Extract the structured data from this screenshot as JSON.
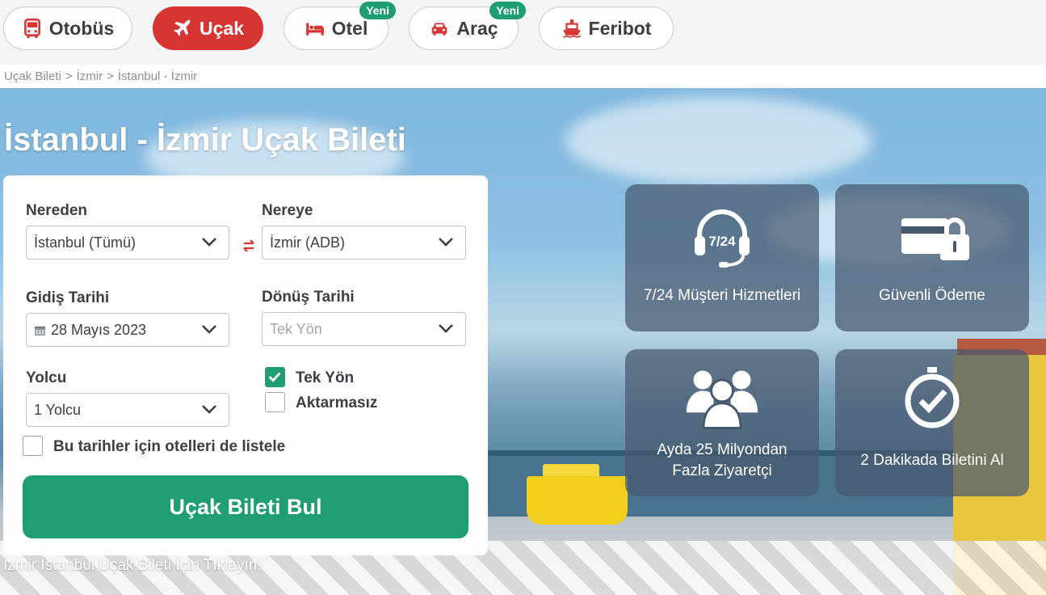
{
  "tabs": [
    {
      "label": "Otobüs",
      "icon": "bus-icon"
    },
    {
      "label": "Uçak",
      "icon": "plane-icon",
      "active": true
    },
    {
      "label": "Otel",
      "icon": "bed-icon",
      "badge": "Yeni"
    },
    {
      "label": "Araç",
      "icon": "car-icon",
      "badge": "Yeni"
    },
    {
      "label": "Feribot",
      "icon": "ferry-icon"
    }
  ],
  "breadcrumb": [
    "Uçak Bileti",
    "İzmir",
    "İstanbul - İzmir"
  ],
  "breadcrumb_sep": ">",
  "hero": {
    "title": "İstanbul - İzmir Uçak Bileti"
  },
  "form": {
    "from_label": "Nereden",
    "from_value": "İstanbul (Tümü)",
    "to_label": "Nereye",
    "to_value": "İzmir (ADB)",
    "depart_label": "Gidiş Tarihi",
    "depart_value": "28 Mayıs 2023",
    "return_label": "Dönüş Tarihi",
    "return_placeholder": "Tek Yön",
    "passenger_label": "Yolcu",
    "passenger_value": "1 Yolcu",
    "oneway_label": "Tek Yön",
    "oneway_checked": true,
    "direct_label": "Aktarmasız",
    "direct_checked": false,
    "hotels_label": "Bu tarihler için otelleri de listele",
    "hotels_checked": false,
    "submit_label": "Uçak Bileti Bul"
  },
  "reverse_link": "İzmir İstanbul Uçak Bileti İçin Tıklayın!",
  "features": [
    {
      "icon": "headset-icon",
      "icon_text": "7/24",
      "text": "7/24 Müşteri Hizmetleri"
    },
    {
      "icon": "secure-card-icon",
      "text": "Güvenli Ödeme"
    },
    {
      "icon": "users-icon",
      "text_line1": "Ayda 25 Milyondan",
      "text_line2": "Fazla Ziyaretçi"
    },
    {
      "icon": "timer-check-icon",
      "text": "2 Dakikada Biletini Al"
    }
  ],
  "colors": {
    "brand_red": "#d63532",
    "brand_green": "#1f9d73"
  }
}
